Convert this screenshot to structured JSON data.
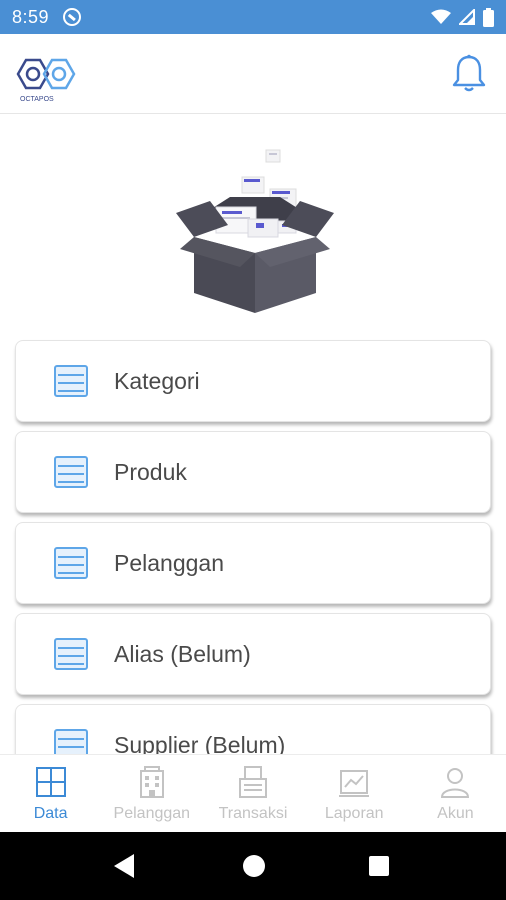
{
  "status_bar": {
    "time": "8:59",
    "bg_color": "#4a8fd4",
    "icons": [
      "app-notification-icon",
      "wifi-icon",
      "signal-icon",
      "battery-icon"
    ]
  },
  "header": {
    "logo_text": "OCTAPOS",
    "notification_icon": "bell-icon",
    "accent_color": "#4a90e2"
  },
  "hero_icon": "open-box-illustration",
  "menu": {
    "items": [
      {
        "label": "Kategori",
        "icon": "list-icon"
      },
      {
        "label": "Produk",
        "icon": "list-icon"
      },
      {
        "label": "Pelanggan",
        "icon": "list-icon"
      },
      {
        "label": "Alias (Belum)",
        "icon": "list-icon"
      },
      {
        "label": "Supplier (Belum)",
        "icon": "list-icon"
      }
    ]
  },
  "bottom_nav": {
    "items": [
      {
        "label": "Data",
        "icon": "grid-icon",
        "active": true
      },
      {
        "label": "Pelanggan",
        "icon": "building-icon",
        "active": false
      },
      {
        "label": "Transaksi",
        "icon": "register-icon",
        "active": false
      },
      {
        "label": "Laporan",
        "icon": "chart-icon",
        "active": false
      },
      {
        "label": "Akun",
        "icon": "person-icon",
        "active": false
      }
    ],
    "active_color": "#3c8ad6",
    "inactive_color": "#c3c3c3"
  },
  "system_nav": {
    "icons": [
      "back-icon",
      "home-icon",
      "recent-apps-icon"
    ]
  }
}
